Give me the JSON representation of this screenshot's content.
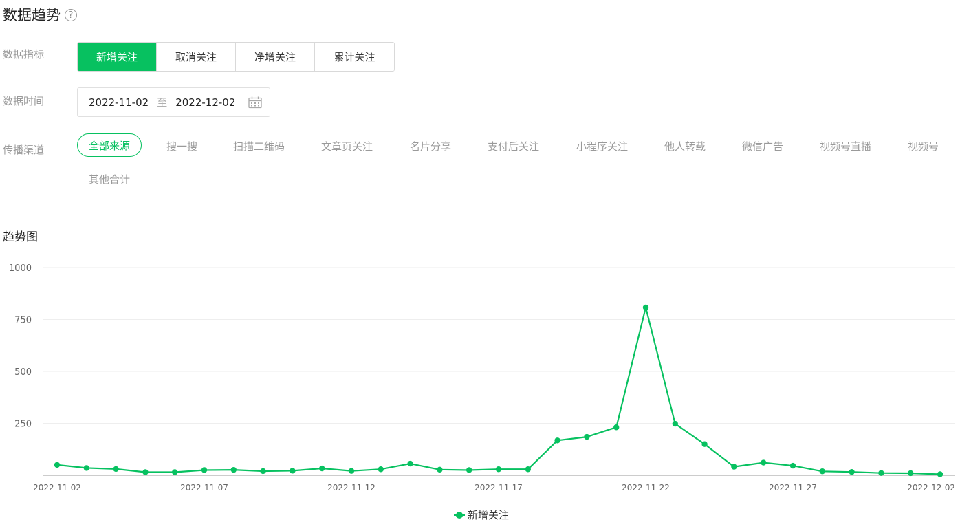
{
  "header": {
    "title": "数据趋势",
    "help_icon": "?"
  },
  "filters": {
    "metric_label": "数据指标",
    "metrics": [
      "新增关注",
      "取消关注",
      "净增关注",
      "累计关注"
    ],
    "active_metric": 0,
    "time_label": "数据时间",
    "date_start": "2022-11-02",
    "date_sep": "至",
    "date_end": "2022-12-02",
    "channel_label": "传播渠道",
    "channels": [
      "全部来源",
      "搜一搜",
      "扫描二维码",
      "文章页关注",
      "名片分享",
      "支付后关注",
      "小程序关注",
      "他人转载",
      "微信广告",
      "视频号直播",
      "视频号",
      "其他合计"
    ],
    "active_channel": 0
  },
  "chart_title": "趋势图",
  "colors": {
    "accent": "#07c160",
    "grid": "#eeeeee",
    "axis": "#cccccc",
    "tick": "#666666"
  },
  "chart_data": {
    "type": "line",
    "x": [
      "2022-11-02",
      "2022-11-03",
      "2022-11-04",
      "2022-11-05",
      "2022-11-06",
      "2022-11-07",
      "2022-11-08",
      "2022-11-09",
      "2022-11-10",
      "2022-11-11",
      "2022-11-12",
      "2022-11-13",
      "2022-11-14",
      "2022-11-15",
      "2022-11-16",
      "2022-11-17",
      "2022-11-18",
      "2022-11-19",
      "2022-11-20",
      "2022-11-21",
      "2022-11-22",
      "2022-11-23",
      "2022-11-24",
      "2022-11-25",
      "2022-11-26",
      "2022-11-27",
      "2022-11-28",
      "2022-11-29",
      "2022-11-30",
      "2022-12-01",
      "2022-12-02"
    ],
    "x_tick_labels": [
      "2022-11-02",
      "2022-11-07",
      "2022-11-12",
      "2022-11-17",
      "2022-11-22",
      "2022-11-27",
      "2022-12-02"
    ],
    "series": [
      {
        "name": "新增关注",
        "values": [
          50,
          35,
          30,
          15,
          15,
          25,
          26,
          20,
          22,
          33,
          21,
          29,
          56,
          27,
          25,
          29,
          29,
          168,
          185,
          231,
          808,
          248,
          150,
          41,
          61,
          46,
          19,
          16,
          11,
          10,
          5
        ]
      }
    ],
    "yticks": [
      250,
      500,
      750,
      1000
    ],
    "ylim": [
      0,
      1000
    ],
    "grid": true,
    "legend": "bottom-center"
  }
}
